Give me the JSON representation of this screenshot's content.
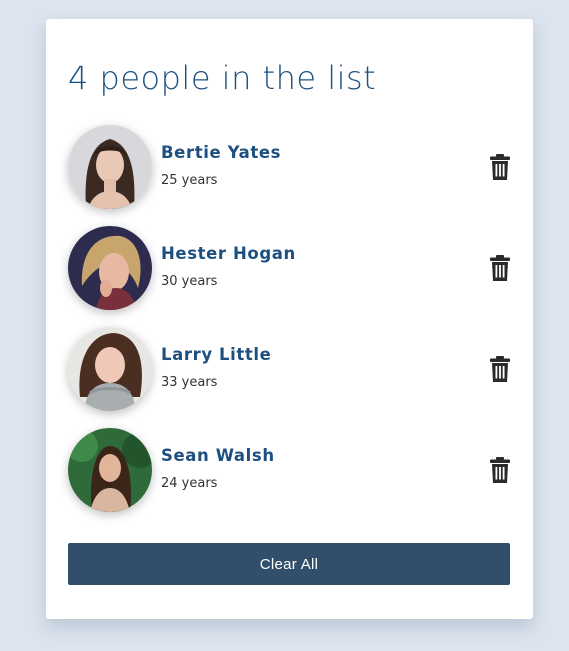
{
  "header": {
    "title": "4 people in the list"
  },
  "people": [
    {
      "name": "Bertie Yates",
      "age": "25 years"
    },
    {
      "name": "Hester Hogan",
      "age": "30 years"
    },
    {
      "name": "Larry Little",
      "age": "33 years"
    },
    {
      "name": "Sean Walsh",
      "age": "24 years"
    }
  ],
  "actions": {
    "clear_label": "Clear All"
  },
  "icons": {
    "delete": "trash-icon"
  },
  "colors": {
    "background": "#dce4ef",
    "card": "#ffffff",
    "accent_text": "#1d5080",
    "button": "#314e6a"
  }
}
